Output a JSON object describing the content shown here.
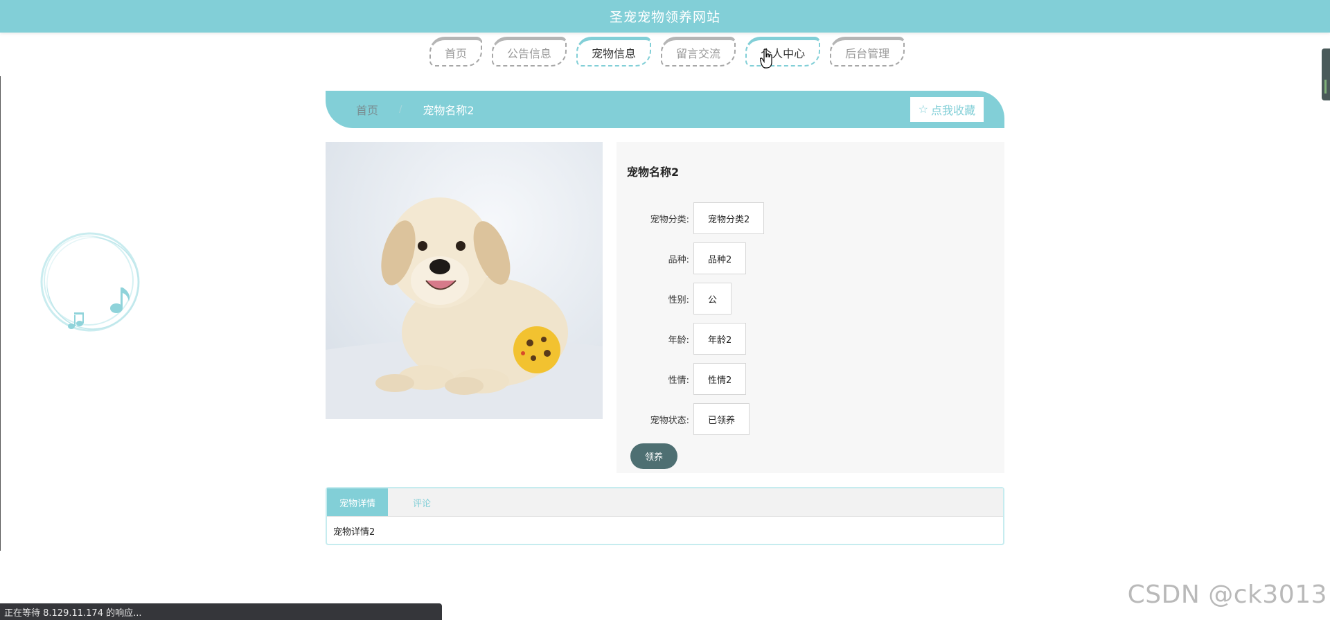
{
  "header": {
    "title": "圣宠宠物领养网站"
  },
  "nav": {
    "items": [
      {
        "label": "首页",
        "state": "normal"
      },
      {
        "label": "公告信息",
        "state": "normal"
      },
      {
        "label": "宠物信息",
        "state": "active"
      },
      {
        "label": "留言交流",
        "state": "normal"
      },
      {
        "label": "个人中心",
        "state": "hover"
      },
      {
        "label": "后台管理",
        "state": "normal"
      }
    ]
  },
  "breadcrumb": {
    "home": "首页",
    "separator": "/",
    "current": "宠物名称2",
    "favorite_label": "点我收藏",
    "favorite_icon": "star-outline-icon"
  },
  "pet": {
    "name": "宠物名称2",
    "image_alt": "labrador-puppy-with-ball",
    "fields": [
      {
        "label": "宠物分类:",
        "value": "宠物分类2"
      },
      {
        "label": "品种:",
        "value": "品种2"
      },
      {
        "label": "性别:",
        "value": "公"
      },
      {
        "label": "年龄:",
        "value": "年龄2"
      },
      {
        "label": "性情:",
        "value": "性情2"
      },
      {
        "label": "宠物状态:",
        "value": "已领养"
      }
    ],
    "adopt_label": "领养"
  },
  "tabs": {
    "items": [
      {
        "label": "宠物详情",
        "active": true
      },
      {
        "label": "评论",
        "active": false
      }
    ],
    "content": "宠物详情2"
  },
  "status_bar": {
    "text": "正在等待 8.129.11.174 的响应..."
  },
  "watermark": {
    "text": "CSDN @ck3013"
  },
  "colors": {
    "accent": "#82cfd7",
    "adopt_button": "#4e6f72",
    "panel_bg": "#f7f7f7"
  }
}
